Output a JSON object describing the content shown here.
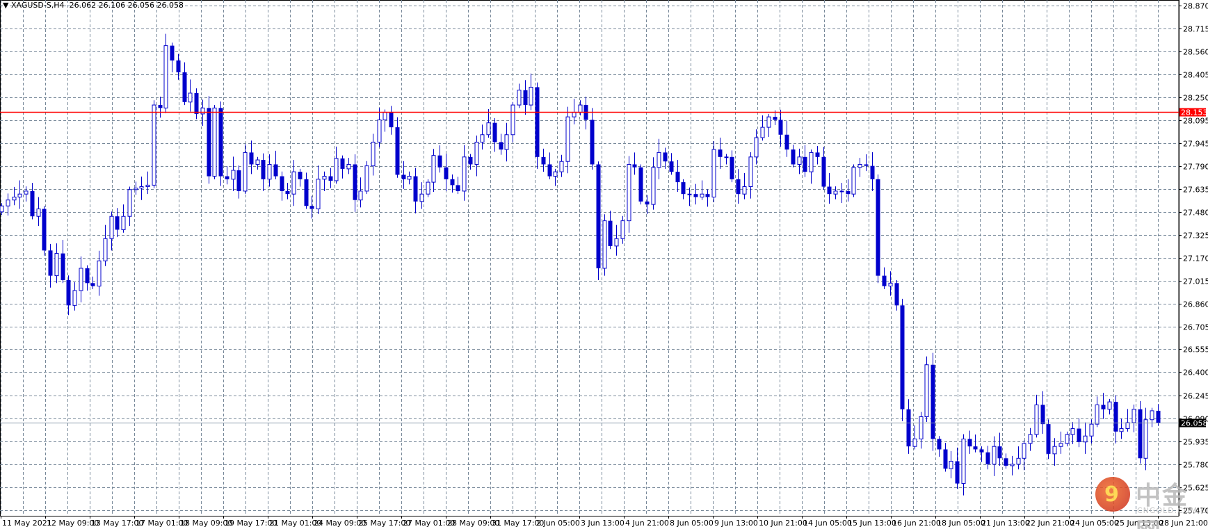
{
  "header": {
    "dropdown_icon": "triangle-down-icon",
    "symbol": "XAGUSD-S,H4",
    "ohlc_readout": "26.062 26.106 26.056 26.058"
  },
  "watermark": {
    "brand": "中金网",
    "domain": "CNGOLD.COM.CN",
    "tagline": "中文财经黄金媒体"
  },
  "colors": {
    "candle": "#0000CC",
    "grid": "#778899",
    "level_line": "#FF0000",
    "price_line": "#8899AA",
    "background": "#FFFFFF"
  },
  "chart_data": {
    "type": "candlestick",
    "symbol": "XAGUSD-S",
    "timeframe": "H4",
    "grid": true,
    "ylim": [
      25.47,
      28.87
    ],
    "y_ticks": [
      "28.870",
      "28.715",
      "28.560",
      "28.405",
      "28.250",
      "28.095",
      "27.945",
      "27.790",
      "27.635",
      "27.480",
      "27.325",
      "27.170",
      "27.015",
      "26.860",
      "26.705",
      "26.555",
      "26.400",
      "26.245",
      "26.090",
      "25.935",
      "25.780",
      "25.625",
      "25.470"
    ],
    "x_ticks": [
      "11 May 2021",
      "12 May 09:00",
      "13 May 17:00",
      "17 May 01:00",
      "18 May 09:00",
      "19 May 17:00",
      "21 May 01:00",
      "24 May 09:00",
      "25 May 17:00",
      "27 May 01:00",
      "28 May 09:00",
      "31 May 17:00",
      "2 Jun 05:00",
      "3 Jun 13:00",
      "4 Jun 21:00",
      "8 Jun 05:00",
      "9 Jun 13:00",
      "10 Jun 21:00",
      "14 Jun 05:00",
      "15 Jun 13:00",
      "16 Jun 21:00",
      "18 Jun 05:00",
      "21 Jun 13:00",
      "22 Jun 21:00",
      "24 Jun 05:00",
      "25 Jun 13:00",
      "28 Jun 21:00"
    ],
    "horizontal_level": {
      "value": 28.153,
      "label": "28.153"
    },
    "current_price": {
      "value": 26.058,
      "label": "26.058"
    },
    "first_open": 27.48,
    "closes": [
      27.52,
      27.56,
      27.58,
      27.6,
      27.62,
      27.45,
      27.5,
      27.22,
      27.05,
      27.2,
      27.02,
      26.85,
      26.95,
      27.1,
      27.0,
      26.98,
      27.15,
      27.3,
      27.45,
      27.36,
      27.45,
      27.63,
      27.64,
      27.65,
      27.66,
      28.2,
      28.18,
      28.6,
      28.5,
      28.42,
      28.22,
      28.28,
      28.14,
      28.18,
      27.72,
      28.18,
      27.72,
      27.7,
      27.76,
      27.62,
      27.88,
      27.8,
      27.83,
      27.7,
      27.8,
      27.72,
      27.62,
      27.6,
      27.75,
      27.7,
      27.52,
      27.5,
      27.7,
      27.72,
      27.69,
      27.84,
      27.77,
      27.8,
      27.56,
      27.62,
      27.79,
      27.95,
      28.1,
      28.15,
      28.05,
      27.73,
      27.7,
      27.72,
      27.55,
      27.6,
      27.68,
      27.86,
      27.78,
      27.7,
      27.66,
      27.62,
      27.85,
      27.8,
      27.95,
      28.0,
      28.08,
      27.95,
      27.9,
      28.0,
      28.2,
      28.3,
      28.2,
      28.32,
      27.85,
      27.8,
      27.72,
      27.75,
      27.82,
      28.12,
      28.15,
      28.2,
      28.1,
      27.8,
      27.1,
      27.42,
      27.25,
      27.3,
      27.42,
      27.8,
      27.78,
      27.55,
      27.53,
      27.78,
      27.88,
      27.82,
      27.75,
      27.68,
      27.6,
      27.6,
      27.58,
      27.6,
      27.58,
      27.9,
      27.85,
      27.85,
      27.7,
      27.6,
      27.65,
      27.85,
      27.98,
      28.05,
      28.12,
      28.1,
      28.0,
      27.9,
      27.8,
      27.85,
      27.75,
      27.88,
      27.85,
      27.65,
      27.6,
      27.62,
      27.62,
      27.6,
      27.78,
      27.8,
      27.79,
      27.7,
      27.05,
      26.98,
      27.0,
      26.85,
      26.15,
      25.9,
      25.95,
      26.1,
      26.45,
      25.95,
      25.88,
      25.75,
      25.8,
      25.65,
      25.95,
      25.9,
      25.88,
      25.86,
      25.78,
      25.9,
      25.82,
      25.77,
      25.78,
      25.82,
      25.92,
      25.98,
      26.18,
      26.05,
      25.85,
      25.9,
      25.92,
      25.98,
      26.02,
      25.93,
      25.97,
      26.05,
      26.18,
      26.15,
      26.2,
      26.0,
      26.02,
      26.06,
      26.15,
      25.82,
      26.08,
      26.14,
      26.06
    ]
  }
}
